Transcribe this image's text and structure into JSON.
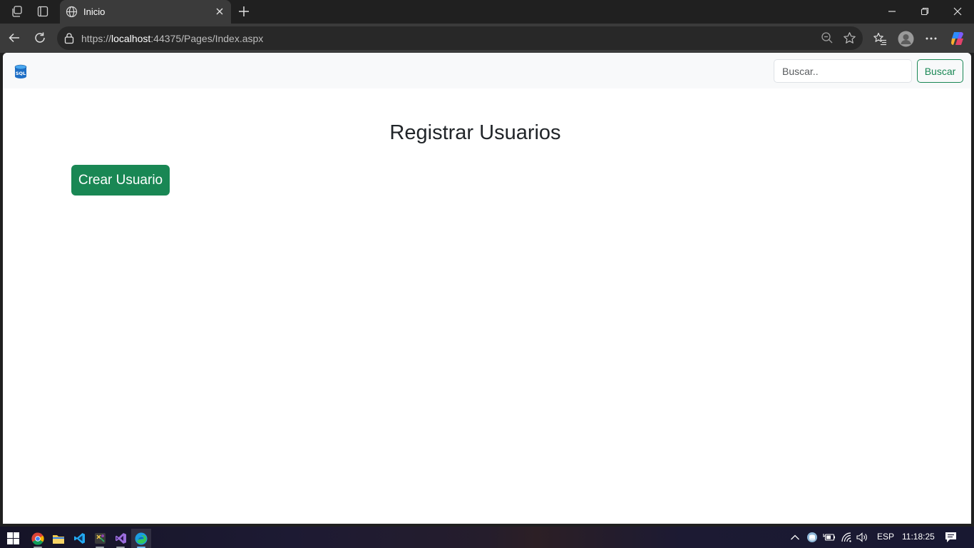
{
  "browser": {
    "tab_title": "Inicio",
    "url_host": "https://localhost",
    "url_host_bold": "localhost",
    "url_prefix": "https://",
    "url_rest": ":44375/Pages/Index.aspx"
  },
  "navbar": {
    "brand_icon": "sql-database-icon",
    "search_placeholder": "Buscar..",
    "search_button": "Buscar"
  },
  "main": {
    "title": "Registrar Usuarios",
    "create_button": "Crear Usuario"
  },
  "taskbar": {
    "language": "ESP",
    "time": "11:18:25"
  },
  "colors": {
    "success": "#198754",
    "chrome_dark": "#202020",
    "chrome_toolbar": "#3b3b3b"
  }
}
